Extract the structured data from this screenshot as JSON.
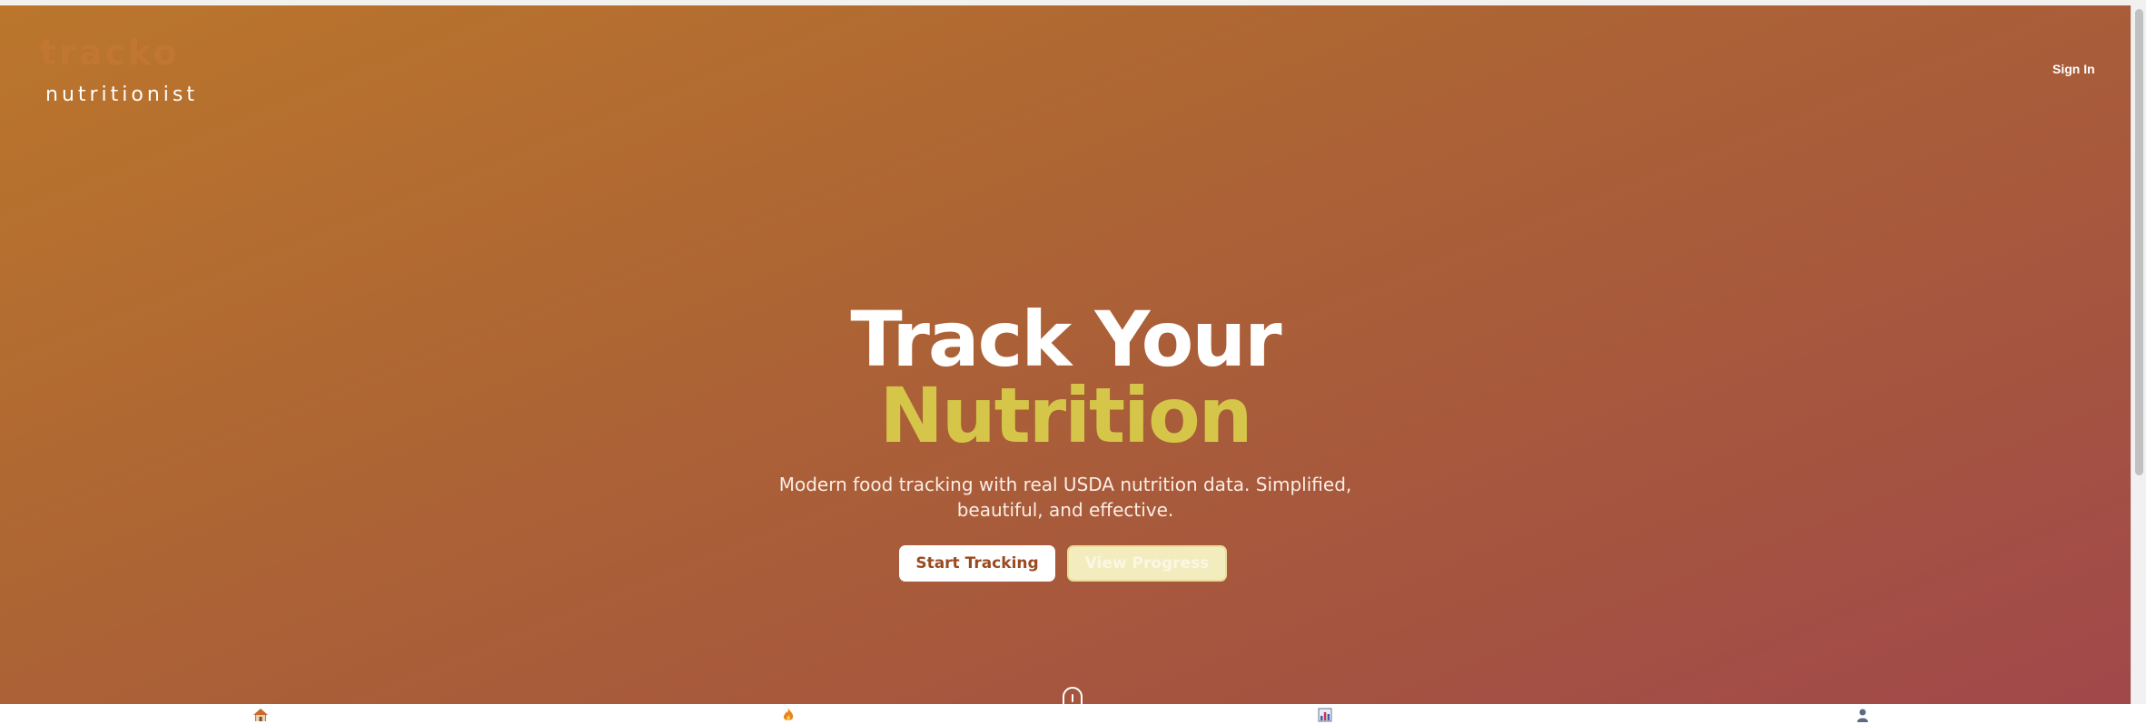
{
  "header": {
    "logo_wordmark": "tracko",
    "logo_subtitle": "nutritionist",
    "signin_label": "Sign In"
  },
  "hero": {
    "headline_line1": "Track Your",
    "headline_line2": "Nutrition",
    "subtitle": "Modern food tracking with real USDA nutrition data. Simplified, beautiful, and effective.",
    "primary_button": "Start Tracking",
    "secondary_button": "View Progress"
  },
  "bottom_nav": {
    "icons": [
      "home-icon",
      "fire-icon",
      "chart-icon",
      "profile-icon"
    ]
  },
  "colors": {
    "gradient_start": "#bb762c",
    "gradient_end": "#a1484b",
    "headline_accent": "#d5c64a",
    "primary_button_text": "#9b4a1f"
  }
}
